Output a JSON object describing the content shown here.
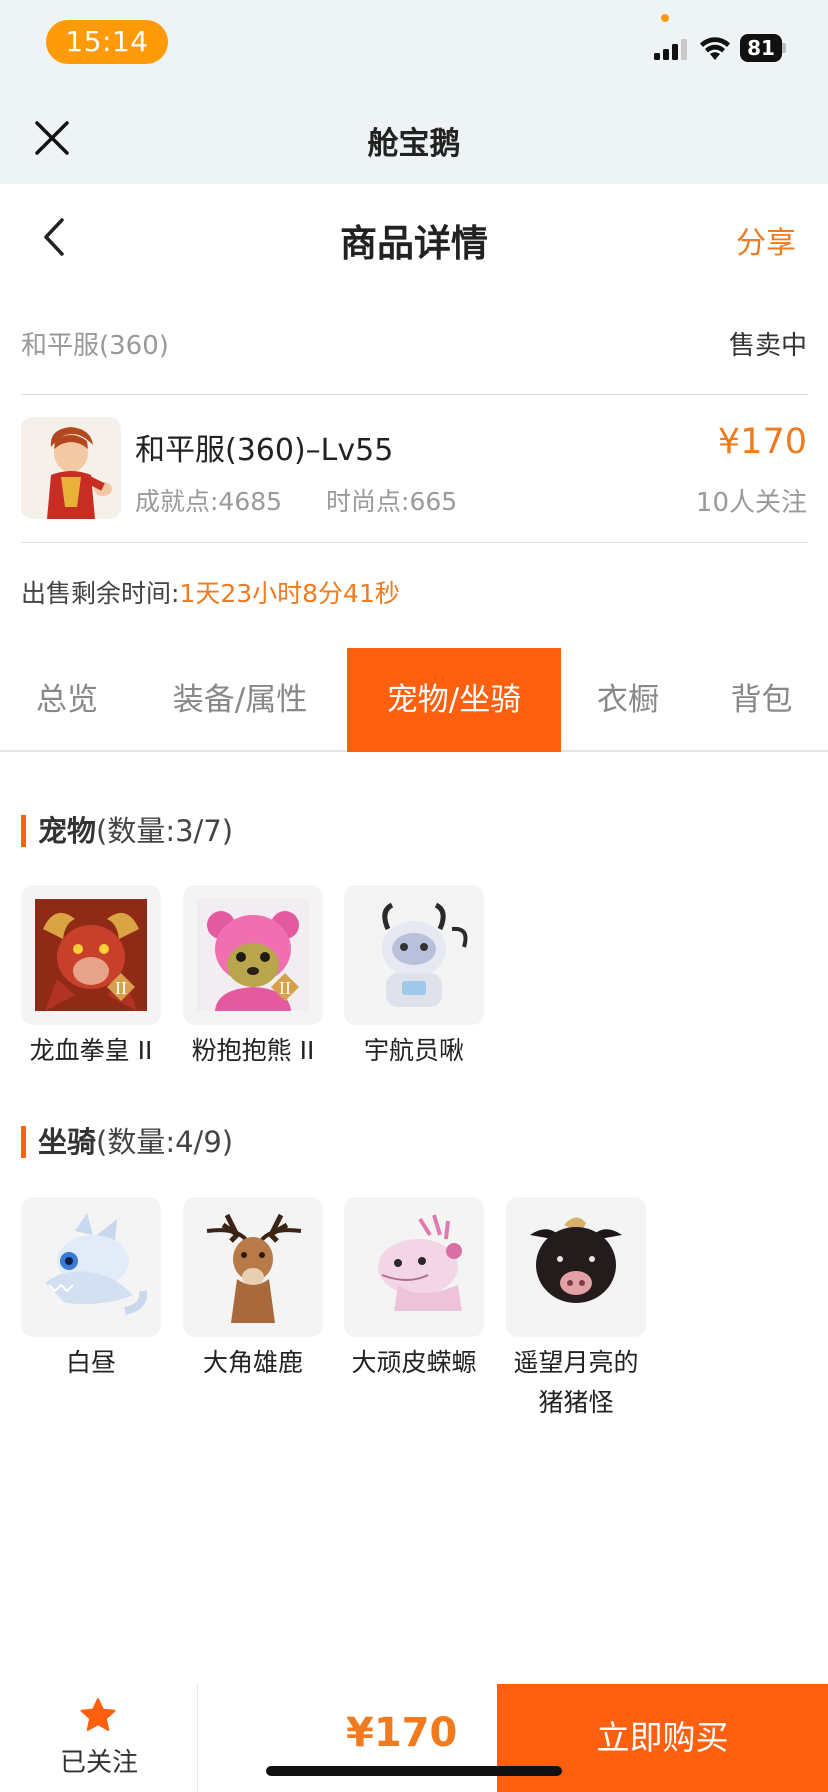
{
  "status_bar": {
    "time": "15:14",
    "battery": "81"
  },
  "app_bar": {
    "title": "舱宝鹅"
  },
  "header": {
    "title": "商品详情",
    "share": "分享"
  },
  "listing": {
    "server": "和平服(360)",
    "status": "售卖中",
    "character_name": "和平服(360)–Lv55",
    "achievement": "成就点:4685",
    "fashion": "时尚点:665",
    "price": "¥170",
    "followers": "10人关注",
    "remaining_label": "出售剩余时间:",
    "remaining_value": "1天23小时8分41秒"
  },
  "tabs": [
    {
      "label": "总览",
      "active": false
    },
    {
      "label": "装备/属性",
      "active": false
    },
    {
      "label": "宠物/坐骑",
      "active": true
    },
    {
      "label": "衣橱",
      "active": false
    },
    {
      "label": "背包",
      "active": false
    }
  ],
  "pets": {
    "title": "宠物",
    "count": "(数量:3/7)",
    "items": [
      {
        "name": "龙血拳皇 II",
        "icon": "red-dragon-pet-icon"
      },
      {
        "name": "粉抱抱熊 II",
        "icon": "pink-bear-pet-icon"
      },
      {
        "name": "宇航员啾",
        "icon": "astronaut-pet-icon"
      }
    ]
  },
  "mounts": {
    "title": "坐骑",
    "count": "(数量:4/9)",
    "items": [
      {
        "name": "白昼",
        "icon": "white-dragon-mount-icon"
      },
      {
        "name": "大角雄鹿",
        "icon": "deer-mount-icon"
      },
      {
        "name": "大顽皮蝾螈",
        "icon": "axolotl-mount-icon"
      },
      {
        "name": "遥望月亮的猪猪怪",
        "icon": "pig-mount-icon"
      }
    ]
  },
  "bottom_bar": {
    "follow_label": "已关注",
    "price": "¥170",
    "buy_label": "立即购买"
  },
  "colors": {
    "accent": "#ff6010",
    "price": "#f07a1e",
    "status_pill": "#ff9a0a"
  }
}
